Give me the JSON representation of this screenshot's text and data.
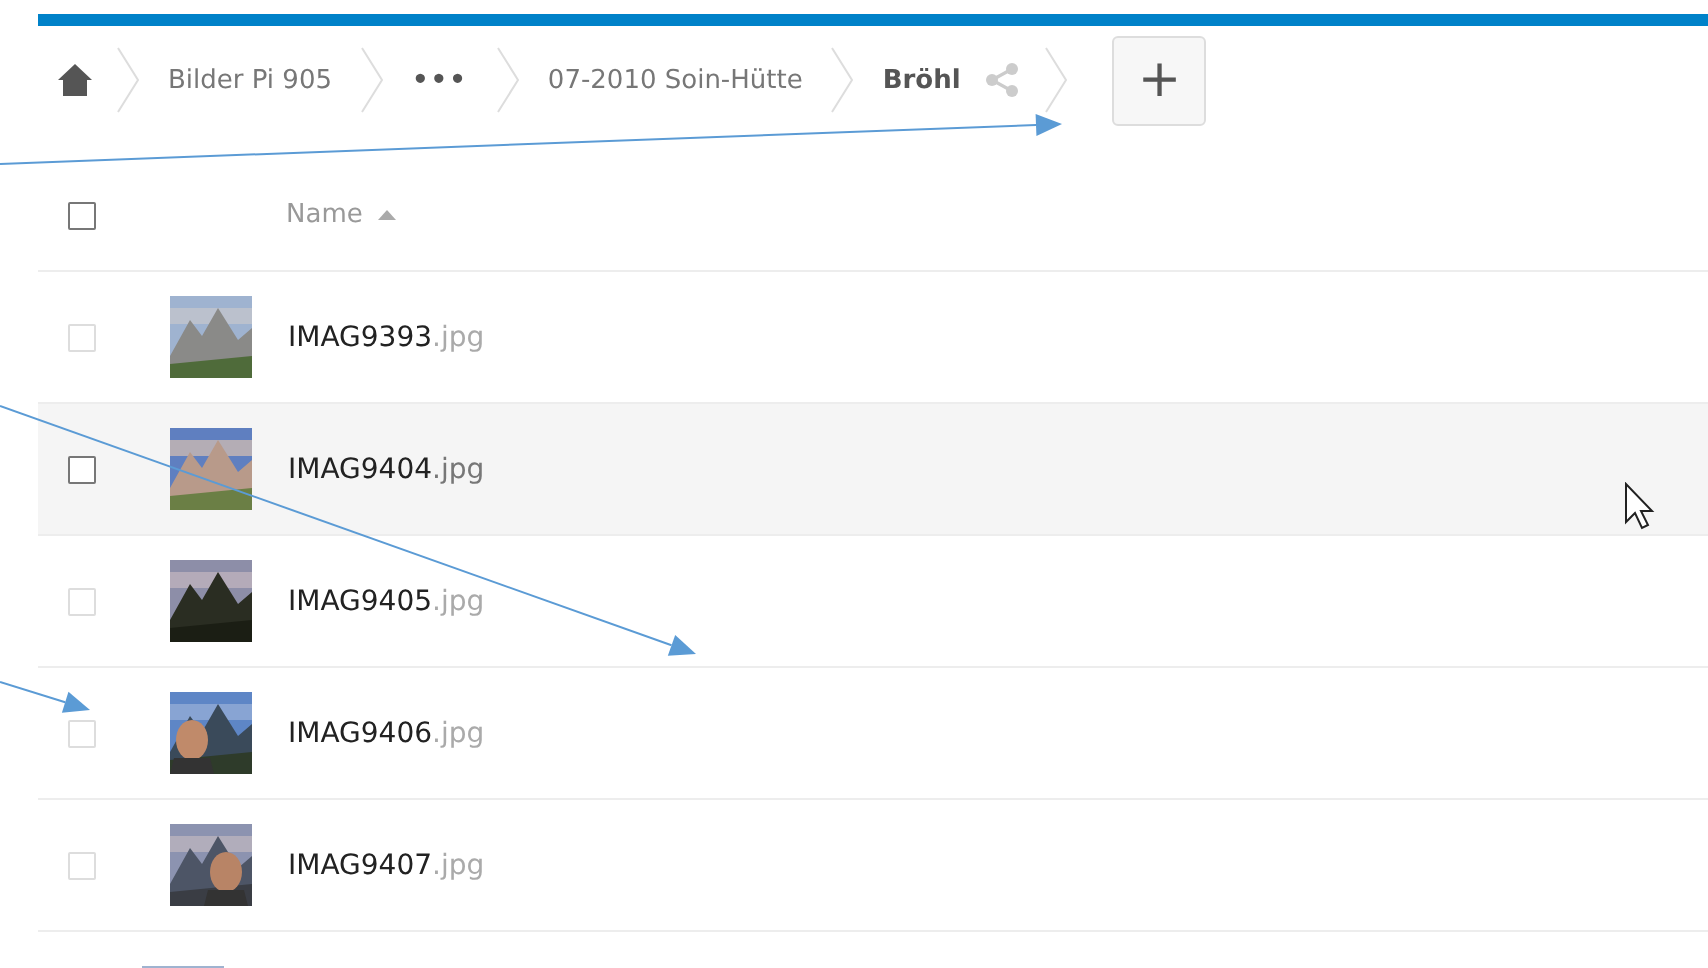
{
  "breadcrumbs": [
    {
      "kind": "home"
    },
    {
      "kind": "folder",
      "label": "Bilder Pi 905"
    },
    {
      "kind": "more",
      "label": "•••"
    },
    {
      "kind": "folder",
      "label": "07-2010 Soin-Hütte"
    },
    {
      "kind": "current",
      "label": "Bröhl"
    },
    {
      "kind": "share"
    }
  ],
  "add_button": {
    "label": "+"
  },
  "header": {
    "checked": false,
    "column": "Name",
    "sort_ascending": true
  },
  "rows": [
    {
      "name": "IMAG9393",
      "extension": ".jpg",
      "checked": false,
      "hovered": false
    },
    {
      "name": "IMAG9404",
      "extension": ".jpg",
      "checked": false,
      "hovered": true
    },
    {
      "name": "IMAG9405",
      "extension": ".jpg",
      "checked": false,
      "hovered": false
    },
    {
      "name": "IMAG9406",
      "extension": ".jpg",
      "checked": false,
      "hovered": false
    },
    {
      "name": "IMAG9407",
      "extension": ".jpg",
      "checked": false,
      "hovered": false
    }
  ]
}
